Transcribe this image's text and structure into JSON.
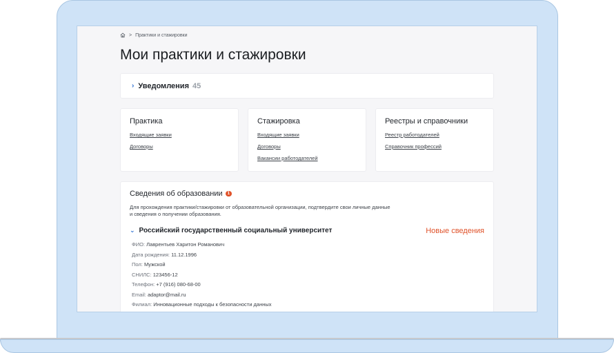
{
  "breadcrumb": {
    "current": "Практики и стажировки",
    "separator": ">"
  },
  "page": {
    "title": "Мои практики и стажировки"
  },
  "notifications": {
    "title": "Уведомления",
    "count": "45"
  },
  "columns": [
    {
      "title": "Практика",
      "links": [
        "Входящие заявки",
        "Договоры"
      ]
    },
    {
      "title": "Стажировка",
      "links": [
        "Входящие заявки",
        "Договоры",
        "Вакансии работодателей"
      ]
    },
    {
      "title": "Реестры и справочники",
      "links": [
        "Реестр работодателей",
        "Справочник профессий"
      ]
    }
  ],
  "education": {
    "title": "Сведения об образовании",
    "badge": "1",
    "description": "Для прохождения практики/стажировки от образовательной организации, подтвердите свои личные данные и сведения о получении образования.",
    "university": "Российский государственный социальный университет",
    "new_info": "Новые сведения",
    "fields": [
      {
        "label": "ФИО:",
        "value": "Лаврентьев Харитон Романович"
      },
      {
        "label": "Дата рождения:",
        "value": "11.12.1996"
      },
      {
        "label": "Пол:",
        "value": "Мужской"
      },
      {
        "label": "СНИЛС:",
        "value": "123456-12"
      },
      {
        "label": "Телефон:",
        "value": "+7 (916) 080-68-00"
      },
      {
        "label": "Email:",
        "value": "adaptor@mail.ru"
      },
      {
        "label": "Филиал:",
        "value": "Инновационные подходы к безопасности данных"
      }
    ]
  },
  "colors": {
    "accent": "#2b6fd1",
    "alert": "#e0532b",
    "frame": "#cfe3f7"
  }
}
